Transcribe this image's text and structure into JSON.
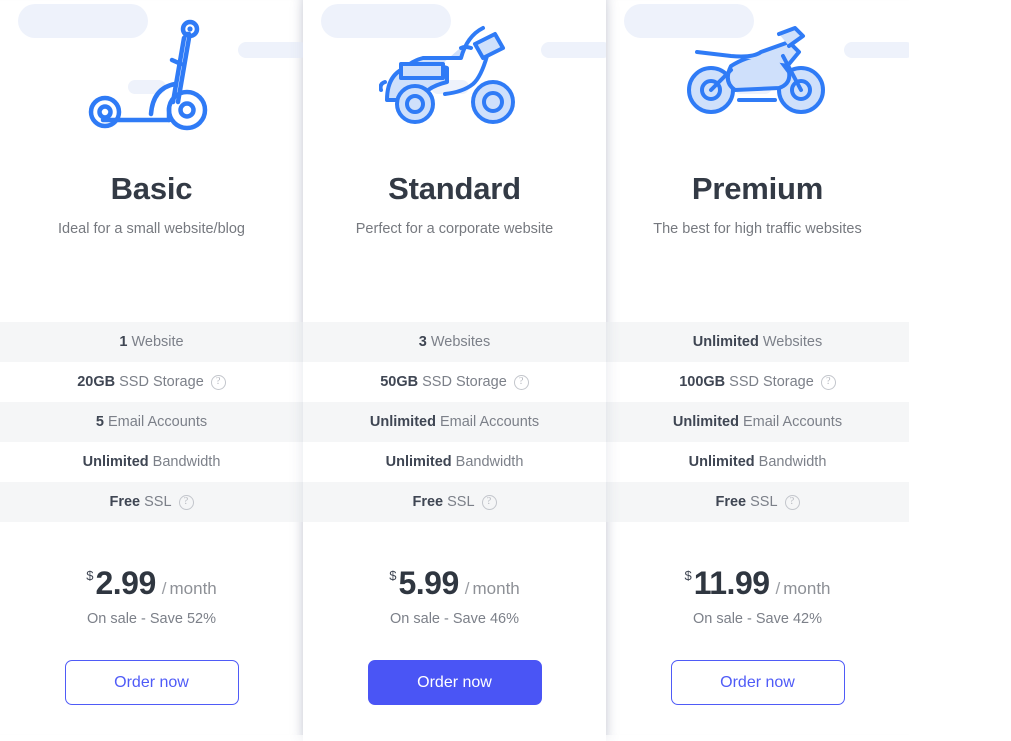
{
  "colors": {
    "accent": "#4a55f5",
    "accent_outline": "#4f5bf7",
    "heading": "#333a45",
    "muted": "#7c8089",
    "row_alt": "#f5f6f7",
    "cloud": "#eef2fb",
    "illustration_blue": "#2f7bf6",
    "illustration_light": "#cfe0fb"
  },
  "plans": [
    {
      "id": "basic",
      "icon": "kick-scooter-icon",
      "name": "Basic",
      "tagline": "Ideal for a small website/blog",
      "features": [
        {
          "value": "1",
          "label": "Website",
          "help": false
        },
        {
          "value": "20GB",
          "label": "SSD Storage",
          "help": true
        },
        {
          "value": "5",
          "label": "Email Accounts",
          "help": false
        },
        {
          "value": "Unlimited",
          "label": "Bandwidth",
          "help": false
        },
        {
          "value": "Free",
          "label": "SSL",
          "help": true
        }
      ],
      "currency": "$",
      "price": "2.99",
      "slash": "/",
      "period": "month",
      "sale": "On sale - Save 52%",
      "cta_label": "Order now",
      "cta_style": "outline",
      "featured": false
    },
    {
      "id": "standard",
      "icon": "vespa-scooter-icon",
      "name": "Standard",
      "tagline": "Perfect for a corporate website",
      "features": [
        {
          "value": "3",
          "label": "Websites",
          "help": false
        },
        {
          "value": "50GB",
          "label": "SSD Storage",
          "help": true
        },
        {
          "value": "Unlimited",
          "label": "Email Accounts",
          "help": false
        },
        {
          "value": "Unlimited",
          "label": "Bandwidth",
          "help": false
        },
        {
          "value": "Free",
          "label": "SSL",
          "help": true
        }
      ],
      "currency": "$",
      "price": "5.99",
      "slash": "/",
      "period": "month",
      "sale": "On sale - Save 46%",
      "cta_label": "Order now",
      "cta_style": "solid",
      "featured": true
    },
    {
      "id": "premium",
      "icon": "motorcycle-icon",
      "name": "Premium",
      "tagline": "The best for high traffic websites",
      "features": [
        {
          "value": "Unlimited",
          "label": "Websites",
          "help": false
        },
        {
          "value": "100GB",
          "label": "SSD Storage",
          "help": true
        },
        {
          "value": "Unlimited",
          "label": "Email Accounts",
          "help": false
        },
        {
          "value": "Unlimited",
          "label": "Bandwidth",
          "help": false
        },
        {
          "value": "Free",
          "label": "SSL",
          "help": true
        }
      ],
      "currency": "$",
      "price": "11.99",
      "slash": "/",
      "period": "month",
      "sale": "On sale - Save 42%",
      "cta_label": "Order now",
      "cta_style": "outline",
      "featured": false
    }
  ],
  "help_glyph": "?"
}
